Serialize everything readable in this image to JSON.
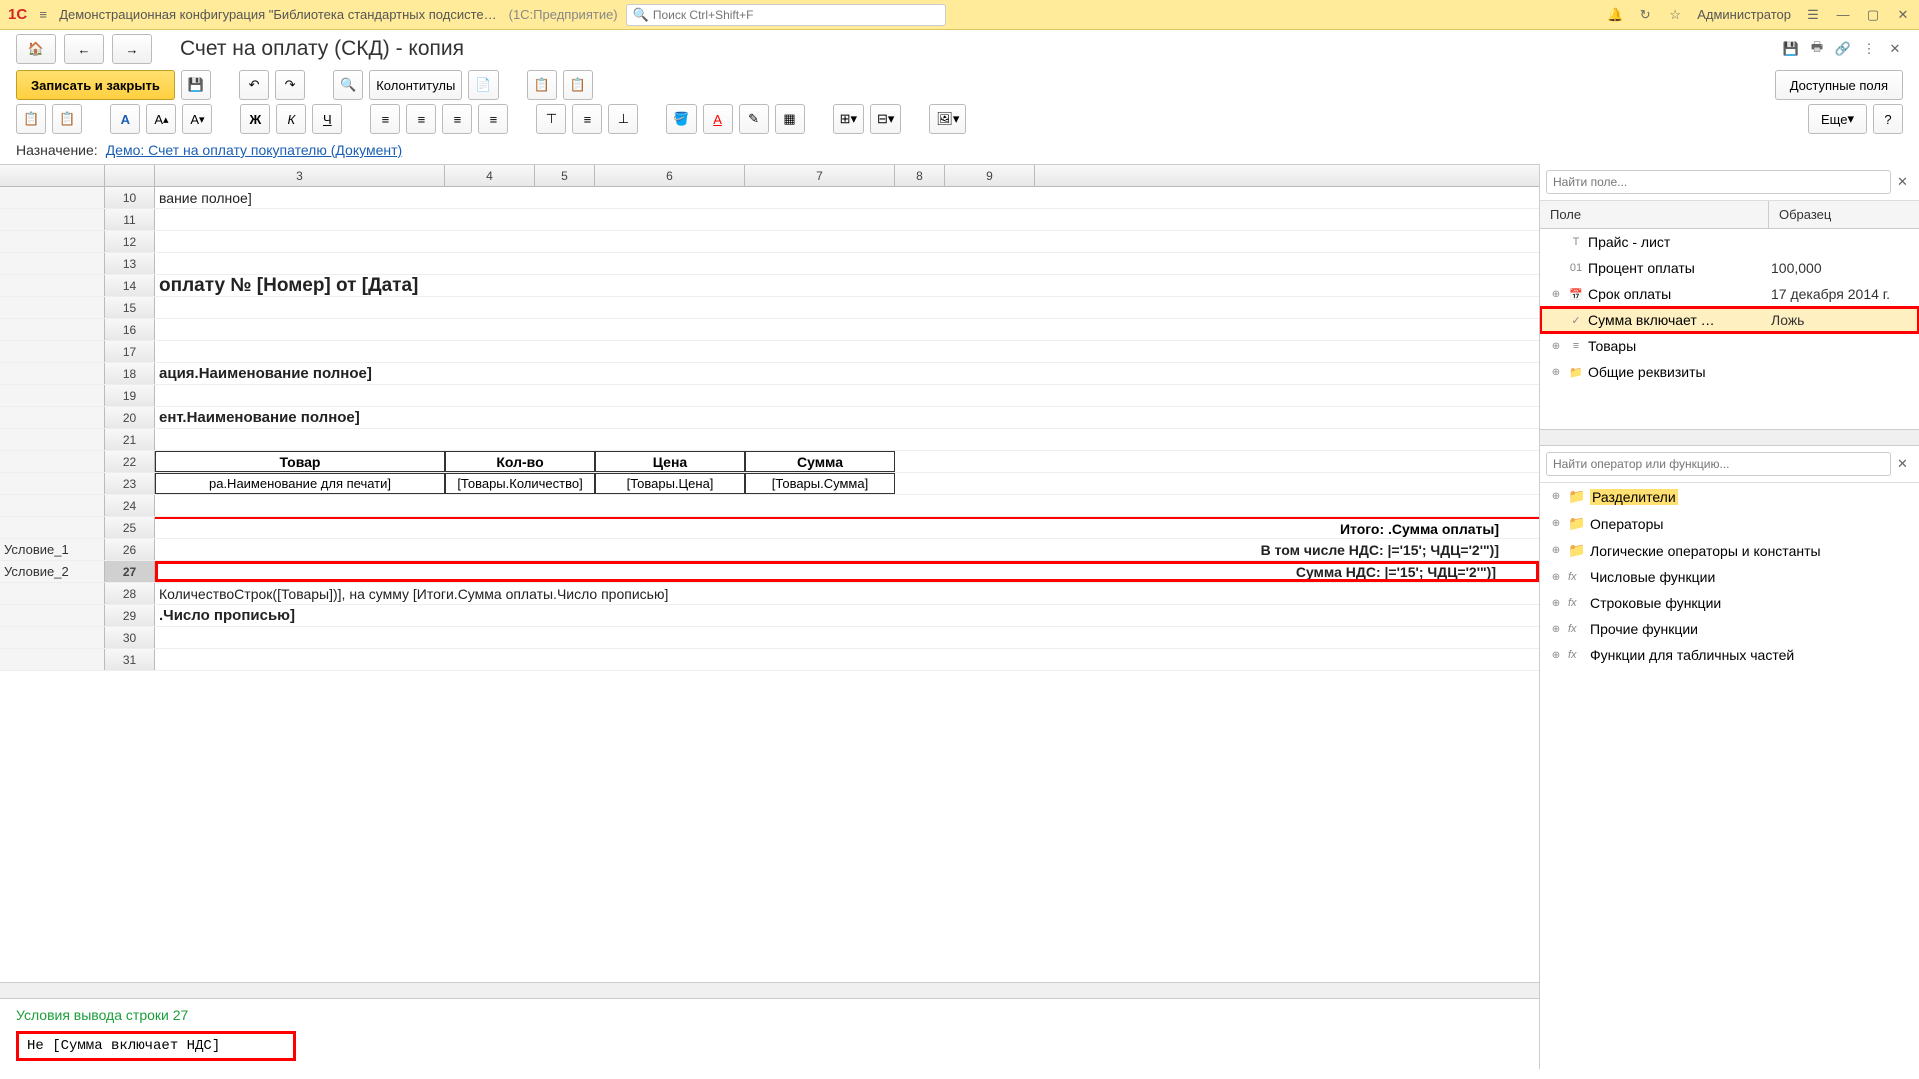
{
  "title_bar": {
    "app_title": "Демонстрационная конфигурация \"Библиотека стандартных подсисте…",
    "platform": "(1С:Предприятие)",
    "search_placeholder": "Поиск Ctrl+Shift+F",
    "admin": "Администратор"
  },
  "nav": {
    "page_title": "Счет на оплату (СКД) - копия"
  },
  "toolbar": {
    "save_close": "Записать и закрыть",
    "headers": "Колонтитулы",
    "available_fields": "Доступные поля",
    "more": "Еще",
    "help": "?"
  },
  "assign": {
    "label": "Назначение:",
    "link": "Демо: Счет на оплату покупателю (Документ)"
  },
  "sheet": {
    "columns": [
      "3",
      "4",
      "5",
      "6",
      "7",
      "8",
      "9"
    ],
    "rows": [
      {
        "n": "10",
        "label": "",
        "text": "вание полное]"
      },
      {
        "n": "11",
        "label": "",
        "text": ""
      },
      {
        "n": "12",
        "label": "",
        "text": ""
      },
      {
        "n": "13",
        "label": "",
        "text": ""
      },
      {
        "n": "14",
        "label": "",
        "text": "оплату № [Номер] от [Дата]",
        "cls": "cell-bold"
      },
      {
        "n": "15",
        "label": "",
        "text": ""
      },
      {
        "n": "16",
        "label": "",
        "text": ""
      },
      {
        "n": "17",
        "label": "",
        "text": ""
      },
      {
        "n": "18",
        "label": "",
        "text": "ация.Наименование полное]",
        "cls": "cell-mid"
      },
      {
        "n": "19",
        "label": "",
        "text": ""
      },
      {
        "n": "20",
        "label": "",
        "text": "ент.Наименование полное]",
        "cls": "cell-mid"
      },
      {
        "n": "21",
        "label": "",
        "text": ""
      }
    ],
    "table_head": {
      "n": "22",
      "cols": [
        "Товар",
        "Кол-во",
        "Цена",
        "Сумма"
      ]
    },
    "table_row": {
      "n": "23",
      "cols": [
        "ра.Наименование для печати]",
        "[Товары.Количество]",
        "[Товары.Цена]",
        "[Товары.Сумма]"
      ]
    },
    "r24": {
      "n": "24"
    },
    "r25": {
      "n": "25",
      "text": "Итого: .Сумма оплаты]"
    },
    "r26": {
      "n": "26",
      "label": "Условие_1",
      "text": "В том числе НДС: |='15'; ЧДЦ='2'\")]"
    },
    "r27": {
      "n": "27",
      "label": "Условие_2",
      "text": "Сумма НДС: |='15'; ЧДЦ='2'\")]"
    },
    "r28": {
      "n": "28",
      "text": "КоличествоСтрок([Товары])], на сумму [Итоги.Сумма оплаты.Число прописью]"
    },
    "r29": {
      "n": "29",
      "text": ".Число прописью]",
      "cls": "cell-mid"
    },
    "r30": {
      "n": "30"
    },
    "r31": {
      "n": "31"
    }
  },
  "condition": {
    "title": "Условия вывода строки 27",
    "expr": "Не [Сумма включает НДС]"
  },
  "right_panel": {
    "search_field": "Найти поле...",
    "search_op": "Найти оператор или функцию...",
    "col_field": "Поле",
    "col_sample": "Образец",
    "fields": [
      {
        "icon": "T",
        "name": "Прайс - лист",
        "val": ""
      },
      {
        "icon": "01",
        "name": "Процент оплаты",
        "val": "100,000"
      },
      {
        "icon": "cal",
        "name": "Срок оплаты",
        "val": "17 декабря 2014 г.",
        "expand": true
      },
      {
        "icon": "chk",
        "name": "Сумма включает …",
        "val": "Ложь",
        "selected": true,
        "boxed": true
      },
      {
        "icon": "list",
        "name": "Товары",
        "val": "",
        "expand": true
      },
      {
        "icon": "fold",
        "name": "Общие реквизиты",
        "val": "",
        "expand": true
      }
    ],
    "ops": [
      {
        "name": "Разделители",
        "hl": true
      },
      {
        "name": "Операторы"
      },
      {
        "name": "Логические операторы и константы"
      },
      {
        "name": "Числовые функции",
        "fx": true
      },
      {
        "name": "Строковые функции",
        "fx": true
      },
      {
        "name": "Прочие функции",
        "fx": true
      },
      {
        "name": "Функции для табличных частей",
        "fx": true
      }
    ]
  }
}
